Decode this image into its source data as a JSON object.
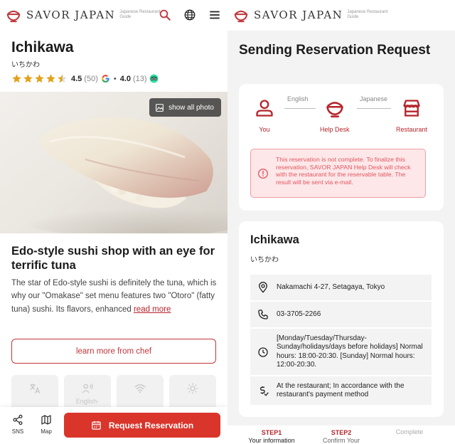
{
  "brand": {
    "name": "SAVOR JAPAN",
    "tagline": "Japanese Restaurant Guide"
  },
  "restaurant": {
    "name": "Ichikawa",
    "name_jp": "いちかわ",
    "rating": {
      "google_score": "4.5",
      "google_count": "(50)",
      "tripadvisor_score": "4.0",
      "tripadvisor_count": "(13)",
      "stars_value": 4.5,
      "stars_max": 5
    },
    "photo_button": "show all photo",
    "headline": "Edo-style sushi shop with an eye for terrific tuna",
    "description": "The star of Edo-style sushi is definitely the tuna, which is why our \"Omakase\" set menu features two \"Otoro\" (fatty tuna) sushi. Its flavors, enhanced",
    "read_more": "read more",
    "learn_more": "learn more from chef",
    "features": [
      {
        "icon": "translate-icon",
        "label": ""
      },
      {
        "icon": "english-speaking-icon",
        "label": "English-"
      },
      {
        "icon": "wifi-icon",
        "label": ""
      },
      {
        "icon": "sun-icon",
        "label": ""
      }
    ]
  },
  "bottom_bar": {
    "sns": "SNS",
    "map": "Map",
    "request": "Request Reservation"
  },
  "reservation": {
    "title": "Sending Reservation Request",
    "flow": {
      "you": "You",
      "help_desk": "Help Desk",
      "restaurant": "Restaurant",
      "lang_left": "English",
      "lang_right": "Japanese"
    },
    "alert": "This reservation is not complete. To finalize this reservation, SAVOR JAPAN Help Desk will check with the restaurant for the reservable table. The result will be sent via e-mail.",
    "card": {
      "name": "Ichikawa",
      "name_jp": "いちかわ",
      "address": "Nakamachi 4-27, Setagaya, Tokyo",
      "phone": "03-3705-2266",
      "hours": "[Monday/Tuesday/Thursday-Sunday/holidays/days before holidays] Normal hours: 18:00-20:30. [Sunday] Normal hours: 12:00-20:30.",
      "payment": "At the restaurant; In accordance with the restaurant's payment method"
    },
    "steps": [
      {
        "num": "STEP1",
        "label": "Your information"
      },
      {
        "num": "STEP2",
        "label": "Confirm Your"
      },
      {
        "num": "",
        "label": "Complete"
      }
    ]
  },
  "colors": {
    "brand_red": "#d9352b",
    "alert_bg": "#fde7e9",
    "alert_text": "#e2575f"
  }
}
